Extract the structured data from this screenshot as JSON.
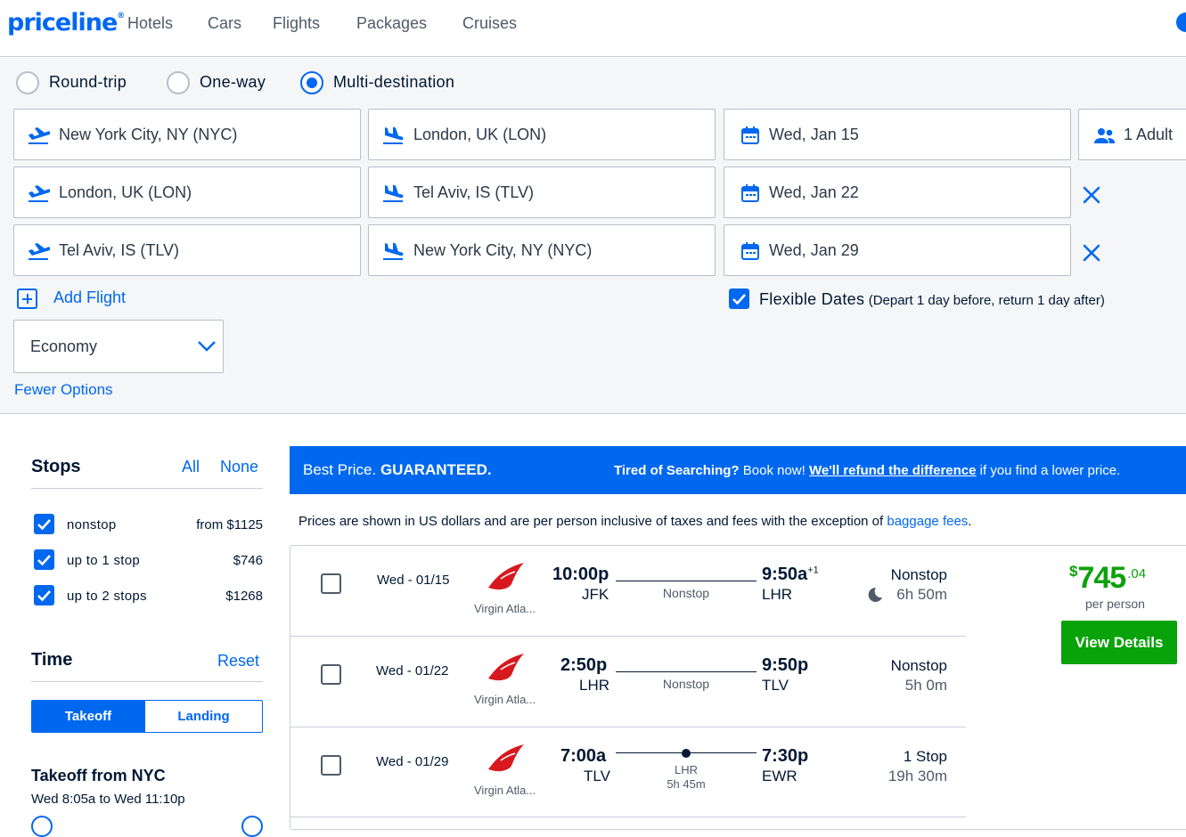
{
  "header": {
    "logo": "priceline",
    "nav": [
      "Hotels",
      "Cars",
      "Flights",
      "Packages",
      "Cruises"
    ]
  },
  "search": {
    "trip_types": [
      {
        "label": "Round-trip",
        "selected": false
      },
      {
        "label": "One-way",
        "selected": false
      },
      {
        "label": "Multi-destination",
        "selected": true
      }
    ],
    "legs": [
      {
        "from": "New York City, NY (NYC)",
        "to": "London, UK (LON)",
        "date": "Wed, Jan 15"
      },
      {
        "from": "London, UK (LON)",
        "to": "Tel Aviv, IS (TLV)",
        "date": "Wed, Jan 22"
      },
      {
        "from": "Tel Aviv, IS (TLV)",
        "to": "New York City, NY (NYC)",
        "date": "Wed, Jan 29"
      }
    ],
    "travelers": "1 Adult",
    "add_flight": "Add Flight",
    "flexible_dates": {
      "label": "Flexible Dates",
      "note": "(Depart 1 day before, return 1 day after)",
      "checked": true
    },
    "cabin": "Economy",
    "fewer_options": "Fewer Options"
  },
  "filters": {
    "stops": {
      "title": "Stops",
      "all": "All",
      "none": "None",
      "options": [
        {
          "label": "nonstop",
          "price": "from $1125",
          "checked": true
        },
        {
          "label": "up to 1 stop",
          "price": "$746",
          "checked": true
        },
        {
          "label": "up to 2 stops",
          "price": "$1268",
          "checked": true
        }
      ]
    },
    "time": {
      "title": "Time",
      "reset": "Reset",
      "tabs": [
        "Takeoff",
        "Landing"
      ],
      "takeoff_title": "Takeoff from NYC",
      "takeoff_range": "Wed 8:05a to Wed 11:10p"
    }
  },
  "banner": {
    "left_normal": "Best Price.",
    "left_bold": "GUARANTEED.",
    "right_bold": "Tired of Searching?",
    "right_text": "Book now!",
    "right_link": "We'll refund the difference",
    "right_tail": "if you find a lower price."
  },
  "disclaimer": {
    "text": "Prices are shown in US dollars and are per person inclusive of taxes and fees with the exception of",
    "link": "baggage fees",
    "end": "."
  },
  "result": {
    "price_currency": "$",
    "price_whole": "745",
    "price_cents": ".04",
    "per_person": "per person",
    "view_details": "View Details",
    "legs": [
      {
        "date": "Wed - 01/15",
        "airline": "Virgin Atla...",
        "dep_time": "10:00p",
        "dep_apt": "JFK",
        "arr_time": "9:50a",
        "arr_plus": "+1",
        "arr_apt": "LHR",
        "mid": "Nonstop",
        "stops": "Nonstop",
        "duration": "6h 50m",
        "overnight": true
      },
      {
        "date": "Wed - 01/22",
        "airline": "Virgin Atla...",
        "dep_time": "2:50p",
        "dep_apt": "LHR",
        "arr_time": "9:50p",
        "arr_plus": "",
        "arr_apt": "TLV",
        "mid": "Nonstop",
        "stops": "Nonstop",
        "duration": "5h 0m",
        "overnight": false
      },
      {
        "date": "Wed - 01/29",
        "airline": "Virgin Atla...",
        "dep_time": "7:00a",
        "dep_apt": "TLV",
        "arr_time": "7:30p",
        "arr_plus": "",
        "arr_apt": "EWR",
        "mid_apt": "LHR",
        "mid_dur": "5h 45m",
        "stops": "1 Stop",
        "duration": "19h 30m",
        "overnight": false
      }
    ]
  },
  "colors": {
    "brand": "#0068ef",
    "price_green": "#0aa20a",
    "airline_red": "#d7191f"
  }
}
